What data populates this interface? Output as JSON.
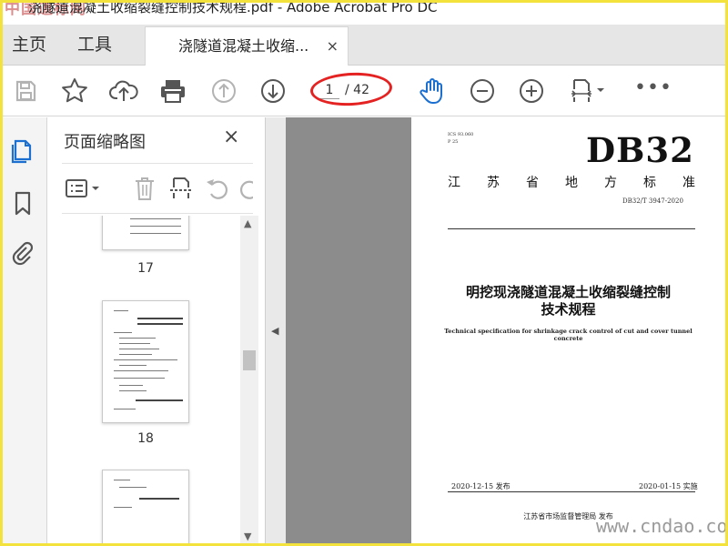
{
  "window": {
    "title": "浇隧道混凝土收缩裂缝控制技术规程.pdf - Adobe Acrobat Pro DC",
    "watermark_logo": "中国道标网"
  },
  "tabs": {
    "home": "主页",
    "tools": "工具",
    "document_tab": "浇隧道混凝土收缩...",
    "close_glyph": "×"
  },
  "toolbar": {
    "page_current": "1",
    "page_total": "/ 42",
    "more_glyph": "•••",
    "icons": [
      "save-icon",
      "bookmark-star-icon",
      "cloud-upload-icon",
      "print-icon",
      "prev-page-icon",
      "next-page-icon",
      "hand-tool-icon",
      "zoom-out-icon",
      "zoom-in-icon",
      "page-fit-icon",
      "more-icon"
    ],
    "accent_color": "#1a6fd1",
    "highlight_color": "#e52222"
  },
  "thumbnails_panel": {
    "title": "页面缩略图",
    "close_glyph": "×",
    "pages": [
      {
        "number": "17"
      },
      {
        "number": "18"
      },
      {
        "number": ""
      }
    ]
  },
  "document": {
    "ics": "ICS 93.060",
    "category": "P 25",
    "code": "DB32",
    "local_standard_chars": [
      "江",
      "苏",
      "省",
      "地",
      "方",
      "标",
      "准"
    ],
    "std_number": "DB32/T 3947-2020",
    "title_cn_line1": "明挖现浇隧道混凝土收缩裂缝控制",
    "title_cn_line2": "技术规程",
    "title_en": "Technical specification for shrinkage crack control of cut and cover tunnel concrete",
    "issue_date": "2020-12-15 发布",
    "impl_date": "2020-01-15 实施",
    "issuer": "江苏省市场监督管理局    发布"
  },
  "watermark_site": "www.cndao.com"
}
